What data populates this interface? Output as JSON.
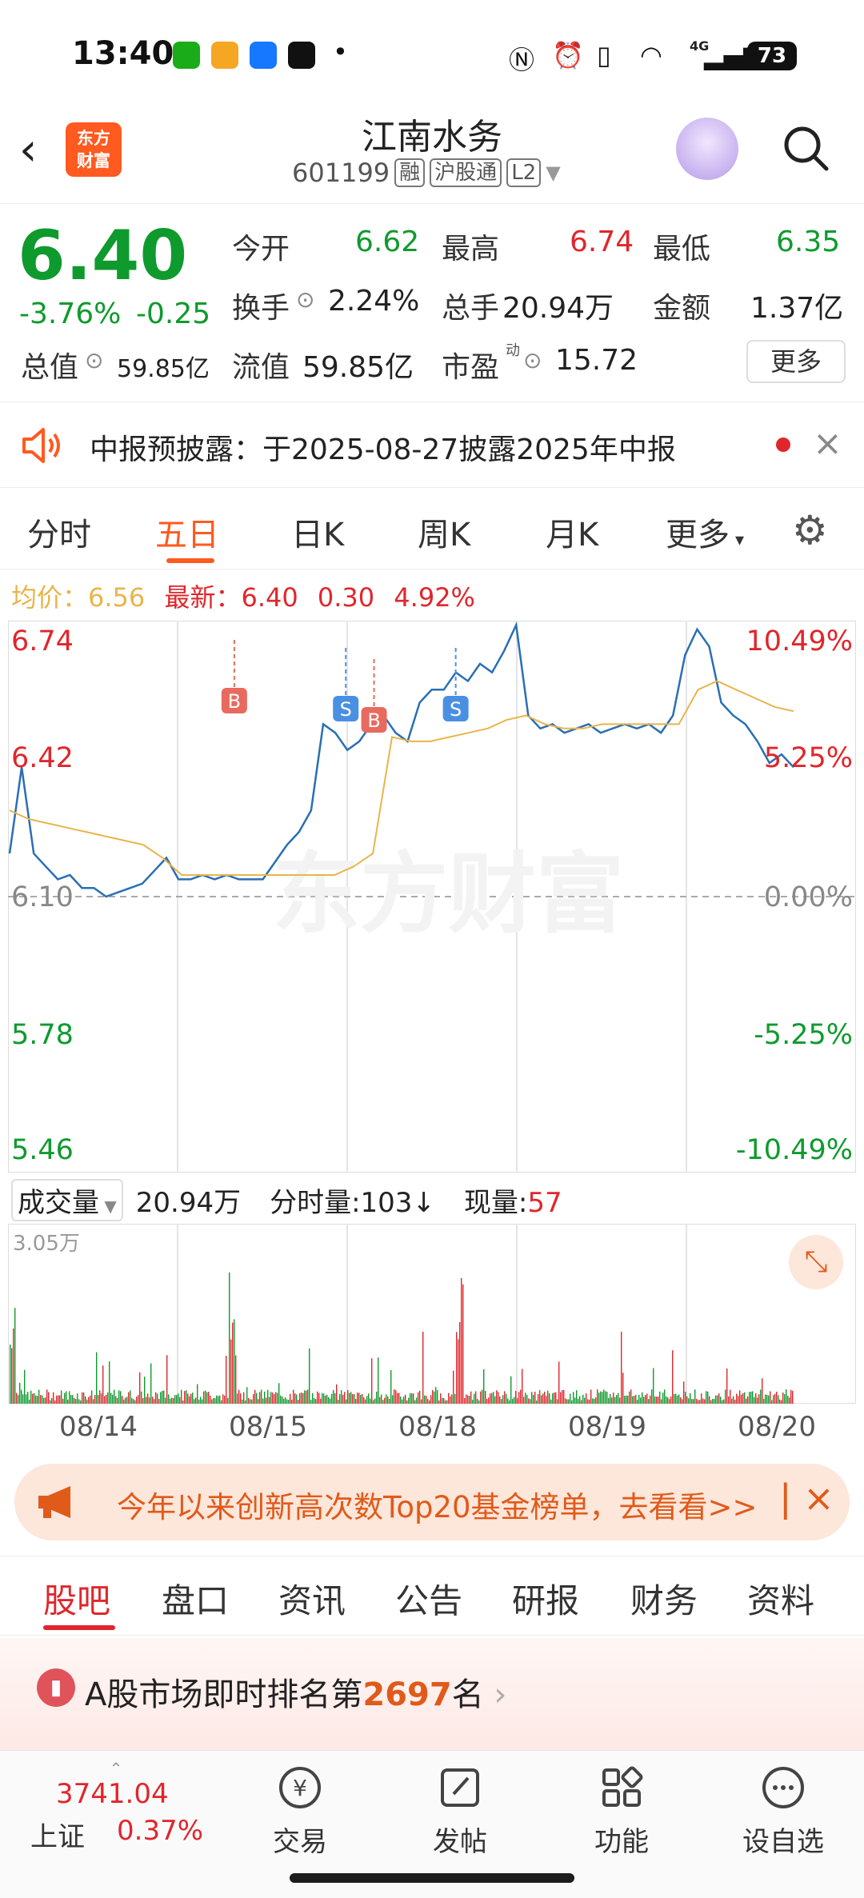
{
  "status_bar": {
    "time": "13:40",
    "battery": "73",
    "network": "4G"
  },
  "header": {
    "stock_name": "江南水务",
    "stock_code": "601199",
    "tags": [
      "融",
      "沪股通",
      "L2"
    ],
    "logo_text": [
      "东方",
      "财富"
    ]
  },
  "quote": {
    "price": "6.40",
    "change_pct": "-3.76%",
    "change": "-0.25",
    "open_label": "今开",
    "open": "6.62",
    "high_label": "最高",
    "high": "6.74",
    "low_label": "最低",
    "low": "6.35",
    "turnover_label": "换手",
    "turnover": "2.24%",
    "volume_label": "总手",
    "volume": "20.94万",
    "amount_label": "金额",
    "amount": "1.37亿",
    "mktcap_label": "总值",
    "mktcap": "59.85亿",
    "float_label": "流值",
    "float_cap": "59.85亿",
    "pe_label": "市盈",
    "pe_sup": "动",
    "pe": "15.72",
    "more": "更多"
  },
  "notice": {
    "text": "中报预披露：于2025-08-27披露2025年中报"
  },
  "chart_tabs": [
    "分时",
    "五日",
    "日K",
    "周K",
    "月K",
    "更多"
  ],
  "chart_info": {
    "avg_label": "均价：",
    "avg": "6.56",
    "last_label": "最新：",
    "last": "6.40",
    "v1": "0.30",
    "v2": "4.92%"
  },
  "chart_data": {
    "type": "line",
    "y_left_ticks": [
      "6.74",
      "6.42",
      "6.10",
      "5.78",
      "5.46"
    ],
    "y_right_ticks": [
      "10.49%",
      "5.25%",
      "0.00%",
      "-5.25%",
      "-10.49%"
    ],
    "x_dates": [
      "08/14",
      "08/15",
      "08/18",
      "08/19",
      "08/20"
    ],
    "ylim": [
      5.46,
      6.74
    ],
    "prev_close": 6.1,
    "series": [
      {
        "values": [
          6.2,
          6.4,
          6.2,
          6.17,
          6.14,
          6.15,
          6.12,
          6.12,
          6.1,
          6.11,
          6.12,
          6.13,
          6.16,
          6.19,
          6.14,
          6.14,
          6.15,
          6.14,
          6.15,
          6.14,
          6.14,
          6.14,
          6.18,
          6.22,
          6.25,
          6.3,
          6.5,
          6.48,
          6.44,
          6.46,
          6.5,
          6.52,
          6.48,
          6.46,
          6.55,
          6.58,
          6.58,
          6.62,
          6.6,
          6.64,
          6.62,
          6.67,
          6.73,
          6.52,
          6.49,
          6.5,
          6.48,
          6.49,
          6.5,
          6.48,
          6.49,
          6.5,
          6.49,
          6.5,
          6.48,
          6.52,
          6.66,
          6.72,
          6.68,
          6.55,
          6.52,
          6.5,
          6.46,
          6.41,
          6.43,
          6.4
        ]
      },
      {
        "values": [
          6.3,
          6.28,
          6.27,
          6.26,
          6.25,
          6.24,
          6.23,
          6.22,
          6.19,
          6.15,
          6.15,
          6.15,
          6.15,
          6.15,
          6.15,
          6.15,
          6.15,
          6.15,
          6.17,
          6.2,
          6.47,
          6.46,
          6.46,
          6.47,
          6.48,
          6.49,
          6.51,
          6.52,
          6.5,
          6.49,
          6.49,
          6.5,
          6.5,
          6.5,
          6.5,
          6.5,
          6.58,
          6.6,
          6.58,
          6.56,
          6.54,
          6.53
        ]
      }
    ],
    "markers": [
      "B",
      "S",
      "B",
      "S"
    ],
    "volume_ticks": [
      "3.05万"
    ]
  },
  "volume_row": {
    "label": "成交量",
    "total": "20.94万",
    "tick_label": "分时量:103↓",
    "current_label": "现量:",
    "current": "57"
  },
  "promo": {
    "text": "今年以来创新高次数Top20基金榜单，去看看>>"
  },
  "section_tabs": [
    "股吧",
    "盘口",
    "资讯",
    "公告",
    "研报",
    "财务",
    "资料"
  ],
  "rank": {
    "prefix": "A股市场即时排名第",
    "rank": "2697",
    "suffix": "名"
  },
  "bottom_nav": {
    "index_value": "3741.04",
    "index_name": "上证",
    "index_change": "0.37%",
    "items": [
      "交易",
      "发帖",
      "功能",
      "设自选"
    ]
  }
}
